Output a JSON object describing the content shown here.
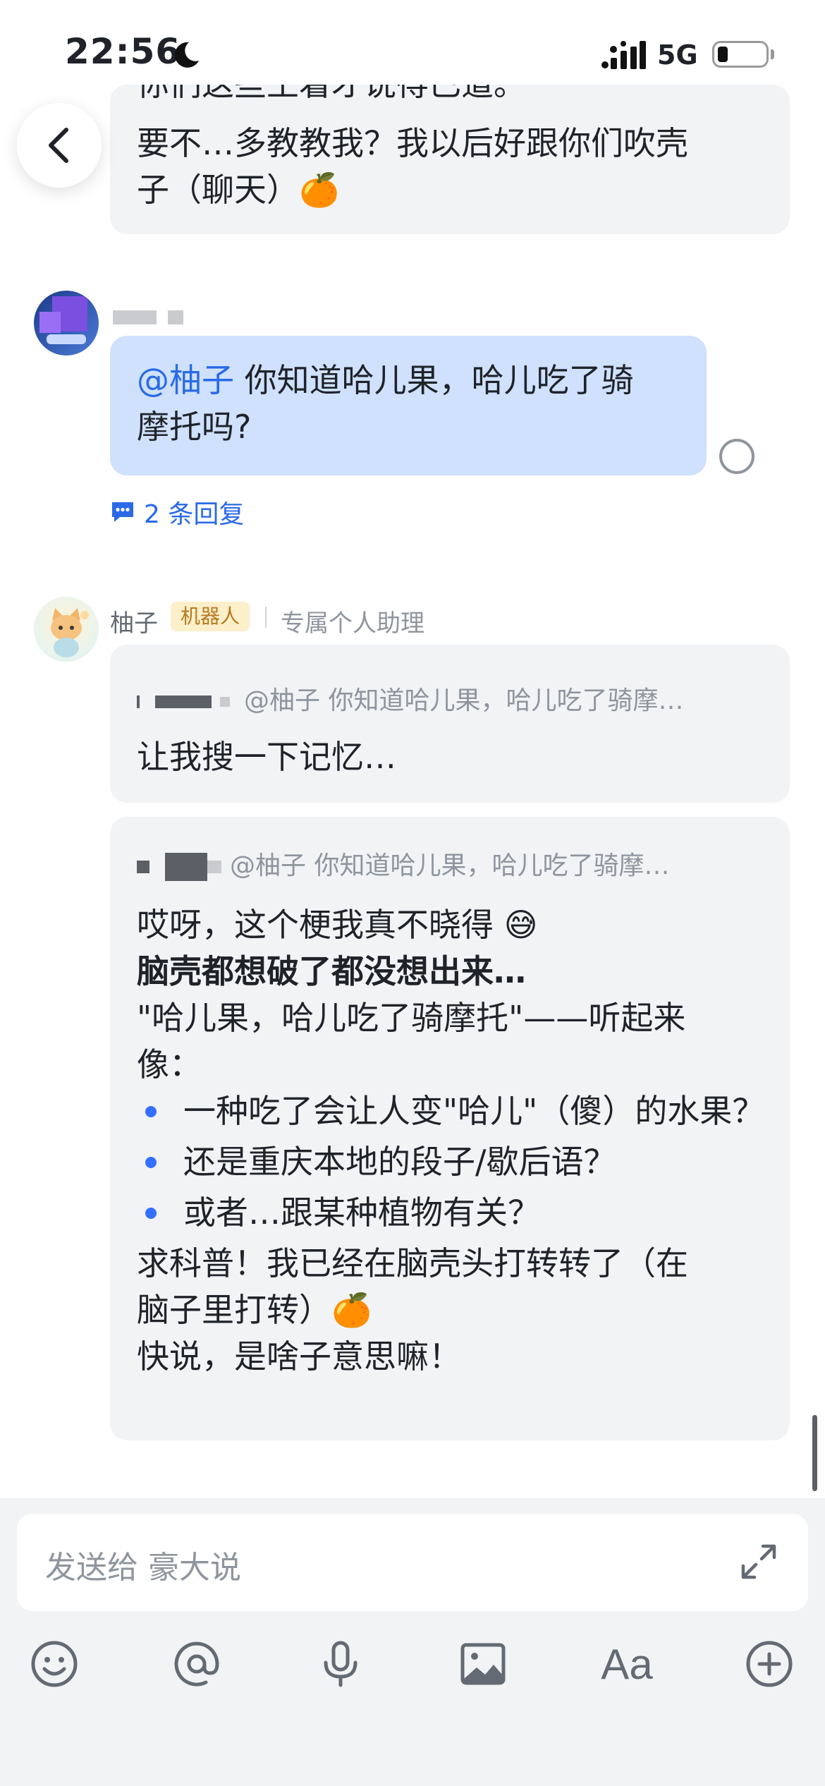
{
  "status_bar": {
    "time": "22:56",
    "network": "5G"
  },
  "previous_message": {
    "line0": "你们这些土着才说得已道。",
    "line1": "要不…多教教我？我以后好跟你们吹壳",
    "line2": "子（聊天）🍊"
  },
  "user_message": {
    "mention": "@柚子",
    "text_line1": " 你知道哈儿果，哈儿吃了骑",
    "text_line2": "摩托吗?",
    "reply_count_label": "2 条回复"
  },
  "bot": {
    "name": "柚子",
    "badge": "机器人",
    "subtitle": "专属个人助理"
  },
  "bot_message_1": {
    "quote": "@柚子 你知道哈儿果，哈儿吃了骑摩…",
    "text": "让我搜一下记忆…"
  },
  "bot_message_2": {
    "quote": "@柚子 你知道哈儿果，哈儿吃了骑摩…",
    "line1": "哎呀，这个梗我真不晓得 😅",
    "line2_bold": "脑壳都想破了都没想出来…",
    "line3": "\"哈儿果，哈儿吃了骑摩托\"——听起来",
    "line4": "像：",
    "bullets": [
      "一种吃了会让人变\"哈儿\"（傻）的水果？",
      "还是重庆本地的段子/歇后语？",
      "或者…跟某种植物有关？"
    ],
    "line5": "求科普！我已经在脑壳头打转转了（在",
    "line6": "脑子里打转）🍊",
    "line7": "快说，是啥子意思嘛！"
  },
  "composer": {
    "placeholder": "发送给 豪大说",
    "font_tool_label": "Aa"
  },
  "colors": {
    "accent": "#2a6ae8",
    "user_bubble": "#cfe1fd",
    "bot_bubble": "#f2f3f5",
    "badge_bg": "#fcefc9",
    "badge_text": "#b7791f"
  },
  "icons": [
    "moon-icon",
    "signal-icon",
    "battery-icon",
    "back-arrow-icon",
    "reply-thread-icon",
    "expand-icon",
    "emoji-icon",
    "at-icon",
    "microphone-icon",
    "image-icon",
    "text-format-icon",
    "plus-icon"
  ]
}
